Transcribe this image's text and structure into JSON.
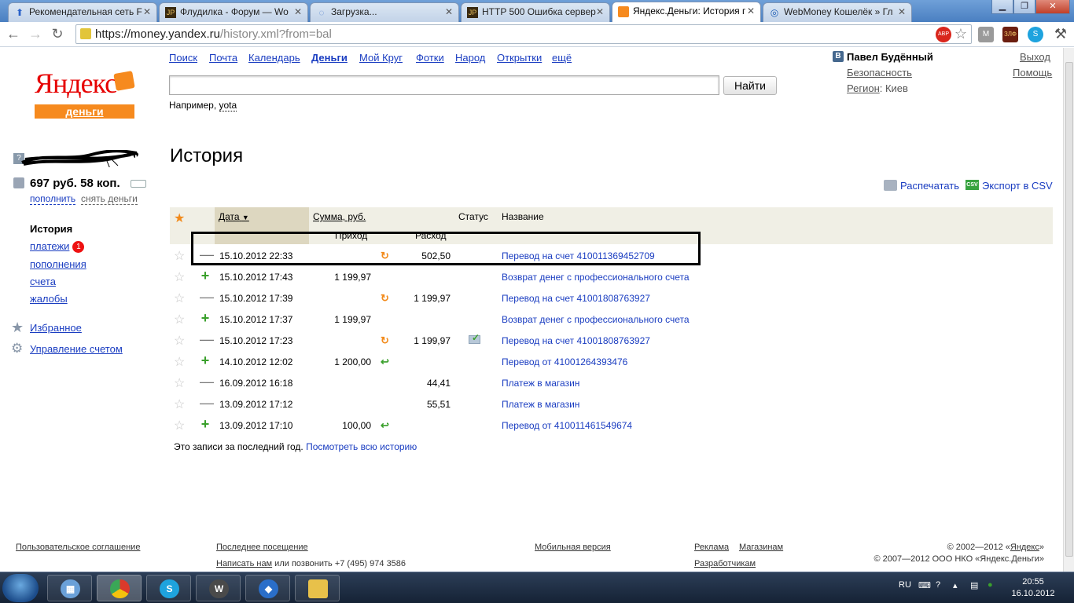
{
  "browser": {
    "tabs": [
      {
        "title": "Рекомендательная сеть F",
        "icon": "upload-arrow-icon"
      },
      {
        "title": "Флудилка - Форум — Wo",
        "icon": "jp-forum-icon"
      },
      {
        "title": "Загрузка...",
        "icon": "loading-spinner-icon"
      },
      {
        "title": "HTTP 500 Ошибка сервер",
        "icon": "jp-forum-icon"
      },
      {
        "title": "Яндекс.Деньги: История г",
        "icon": "yandex-money-icon"
      },
      {
        "title": "WebMoney Кошелёк » Гл",
        "icon": "webmoney-icon"
      }
    ],
    "url_host": "https://money.yandex.ru",
    "url_path": "/history.xml?from=bal",
    "ext_abp": "ABP",
    "ext_zlf": "ЗЛФ"
  },
  "logo": {
    "word": "Яндекс",
    "sub": "деньги"
  },
  "topnav": [
    "Поиск",
    "Почта",
    "Календарь",
    "Деньги",
    "Мой Круг",
    "Фотки",
    "Народ",
    "Открытки",
    "ещё"
  ],
  "search": {
    "value": "",
    "button": "Найти",
    "example_prefix": "Например,",
    "example_word": "yota"
  },
  "user": {
    "badge": "В",
    "name": "Павел Будённый",
    "security": "Безопасность",
    "region_label": "Регион",
    "region_value": ": Киев",
    "logout": "Выход",
    "help": "Помощь"
  },
  "sidebar": {
    "q": "?",
    "balance": "697 руб. 58 коп.",
    "topup": "пополнить",
    "withdraw": "снять деньги",
    "history": "История",
    "payments": "платежи",
    "payments_badge": "1",
    "deposits": "пополнения",
    "bills": "счета",
    "complaints": "жалобы",
    "favorites": "Избранное",
    "account": "Управление счетом"
  },
  "main": {
    "title": "История",
    "print": "Распечатать",
    "csv_badge": "CSV",
    "export": "Экспорт в CSV",
    "note_prefix": "Это записи за последний год.",
    "note_link": "Посмотреть всю историю"
  },
  "table": {
    "col_date": "Дата",
    "sort_arrow": "▼",
    "col_sum": "Сумма, руб.",
    "col_status": "Статус",
    "col_name": "Название",
    "col_in": "Приход",
    "col_out": "Расход",
    "rows": [
      {
        "sign": "—",
        "type": "minus",
        "date": "15.10.2012 22:33",
        "in": "",
        "icon": "↻",
        "icon_type": "exch",
        "out": "502,50",
        "status": "",
        "name": "Перевод на счет 410011369452709"
      },
      {
        "sign": "+",
        "type": "plus",
        "date": "15.10.2012 17:43",
        "in": "1 199,97",
        "icon": "",
        "icon_type": "",
        "out": "",
        "status": "",
        "name": "Возврат денег с профессионального счета"
      },
      {
        "sign": "—",
        "type": "minus",
        "date": "15.10.2012 17:39",
        "in": "",
        "icon": "↻",
        "icon_type": "exch",
        "out": "1 199,97",
        "status": "",
        "name": "Перевод на счет 41001808763927"
      },
      {
        "sign": "+",
        "type": "plus",
        "date": "15.10.2012 17:37",
        "in": "1 199,97",
        "icon": "",
        "icon_type": "",
        "out": "",
        "status": "",
        "name": "Возврат денег с профессионального счета"
      },
      {
        "sign": "—",
        "type": "minus",
        "date": "15.10.2012 17:23",
        "in": "",
        "icon": "↻",
        "icon_type": "exch",
        "out": "1 199,97",
        "status": "envelope",
        "name": "Перевод на счет 41001808763927"
      },
      {
        "sign": "+",
        "type": "plus",
        "date": "14.10.2012 12:02",
        "in": "1 200,00",
        "icon": "↩",
        "icon_type": "back",
        "out": "",
        "status": "",
        "name": "Перевод от 41001264393476"
      },
      {
        "sign": "—",
        "type": "minus",
        "date": "16.09.2012 16:18",
        "in": "",
        "icon": "",
        "icon_type": "",
        "out": "44,41",
        "status": "",
        "name": "Платеж в магазин"
      },
      {
        "sign": "—",
        "type": "minus",
        "date": "13.09.2012 17:12",
        "in": "",
        "icon": "",
        "icon_type": "",
        "out": "55,51",
        "status": "",
        "name": "Платеж в магазин"
      },
      {
        "sign": "+",
        "type": "plus",
        "date": "13.09.2012 17:10",
        "in": "100,00",
        "icon": "↩",
        "icon_type": "back",
        "out": "",
        "status": "",
        "name": "Перевод от 410011461549674"
      }
    ]
  },
  "footer": {
    "agreement": "Пользовательское соглашение",
    "last_visit": "Последнее посещение",
    "write_us": "Написать нам",
    "call_text": " или позвонить +7 (495) 974 3586",
    "mobile": "Мобильная версия",
    "ads": "Реклама",
    "shops": "Магазинам",
    "devs": "Разработчикам",
    "copy1_prefix": "© 2002—2012 «",
    "copy1_link": "Яндекс",
    "copy1_suffix": "»",
    "copy2": "© 2007—2012 ООО НКО «Яндекс.Деньги»"
  },
  "taskbar": {
    "lang": "RU",
    "time": "20:55",
    "date": "16.10.2012"
  },
  "colors": {
    "accent": "#f68a1e",
    "link": "#1a3dc1",
    "brand_red": "#e60000",
    "plus": "#3aa02c"
  }
}
